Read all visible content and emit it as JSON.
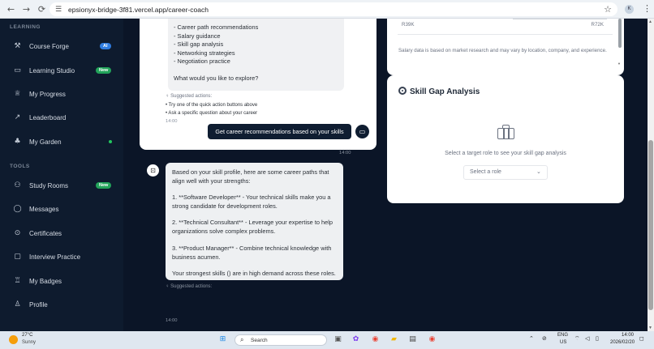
{
  "browser": {
    "url": "epsionyx-bridge-3f81.vercel.app/career-coach",
    "profile_initial": "K"
  },
  "sidebar": {
    "section_learning": "LEARNING",
    "section_tools": "TOOLS",
    "learning_items": [
      {
        "label": "Course Forge",
        "icon": "hammer-icon",
        "badge": "AI"
      },
      {
        "label": "Learning Studio",
        "icon": "book-icon",
        "badge": "New"
      },
      {
        "label": "My Progress",
        "icon": "trophy-icon",
        "badge": ""
      },
      {
        "label": "Leaderboard",
        "icon": "trend-icon",
        "badge": ""
      },
      {
        "label": "My Garden",
        "icon": "plant-icon",
        "badge": ""
      }
    ],
    "tool_items": [
      {
        "label": "Study Rooms",
        "icon": "users-icon",
        "badge": "New"
      },
      {
        "label": "Messages",
        "icon": "chat-icon",
        "badge": ""
      },
      {
        "label": "Certificates",
        "icon": "certificate-icon",
        "badge": ""
      },
      {
        "label": "Interview Practice",
        "icon": "message-square-icon",
        "badge": ""
      },
      {
        "label": "My Badges",
        "icon": "badge-icon",
        "badge": ""
      },
      {
        "label": "Profile",
        "icon": "user-icon",
        "badge": ""
      }
    ]
  },
  "chat": {
    "assistant_msg_1_lines": [
      "- Career path recommendations",
      "- Salary guidance",
      "- Skill gap analysis",
      "- Networking strategies",
      "- Negotiation practice",
      "What would you like to explore?"
    ],
    "suggested_label": "Suggested actions:",
    "suggested_items": [
      "• Try one of the quick action buttons above",
      "• Ask a specific question about your career"
    ],
    "time_1": "14:00",
    "user_message": "Get career recommendations based on your skills",
    "user_time": "14:00",
    "assistant_msg_2_lines": [
      "Based on your skill profile, here are some career paths that",
      "align well with your strengths:",
      "1. **Software Developer** - Your technical skills make you a",
      "strong candidate for development roles.",
      "2. **Technical Consultant** - Leverage your expertise to help",
      "organizations solve complex problems.",
      "3. **Product Manager** - Combine technical knowledge with",
      "business acumen.",
      "Your strongest skills () are in high demand across these roles."
    ],
    "suggested_label_2": "Suggested actions:",
    "time_2": "14:00"
  },
  "salary": {
    "range_low": "R39K",
    "range_high": "R72K",
    "note": "Salary data is based on market research and may vary by location, company, and experience."
  },
  "skill_gap": {
    "title": "Skill Gap Analysis",
    "hint": "Select a target role to see your skill gap analysis",
    "select_placeholder": "Select a role"
  },
  "taskbar": {
    "temp": "27°C",
    "condition": "Sunny",
    "search_label": "Search",
    "lang_1": "ENG",
    "lang_2": "US",
    "time": "14:00",
    "date": "2026/02/20"
  }
}
